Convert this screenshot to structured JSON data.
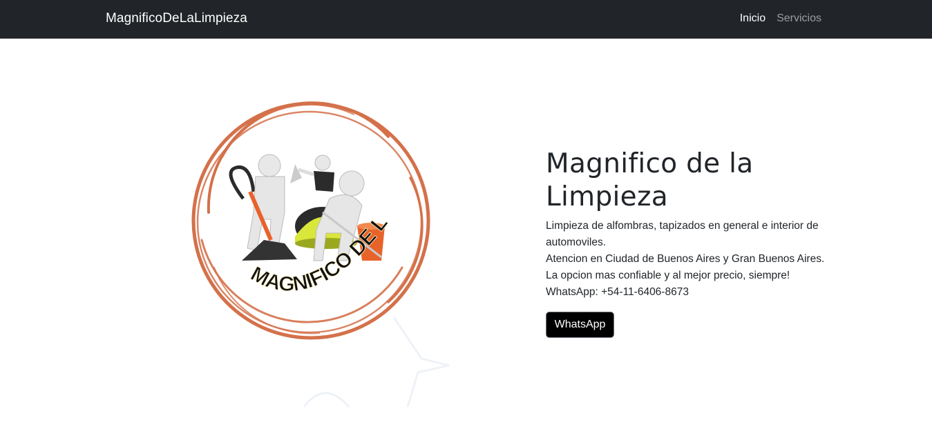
{
  "navbar": {
    "brand": "MagnificoDeLaLimpieza",
    "links": [
      {
        "label": "Inicio",
        "active": true
      },
      {
        "label": "Servicios",
        "active": false
      }
    ]
  },
  "hero": {
    "logo_text": "MAGNIFICO DE LA LIMPIEZA",
    "title": "Magnifico de la Limpieza",
    "lines": [
      "Limpieza de alfombras, tapizados en general e interior de",
      "automoviles.",
      "Atencion en Ciudad de Buenos Aires y Gran Buenos Aires.",
      "La opcion mas confiable y al mejor precio, siempre!",
      "WhatsApp: +54-11-6406-8673"
    ],
    "button_label": "WhatsApp"
  },
  "colors": {
    "navbar_bg": "#212529",
    "logo_ring": "#d4714a",
    "button_bg": "#000000"
  }
}
